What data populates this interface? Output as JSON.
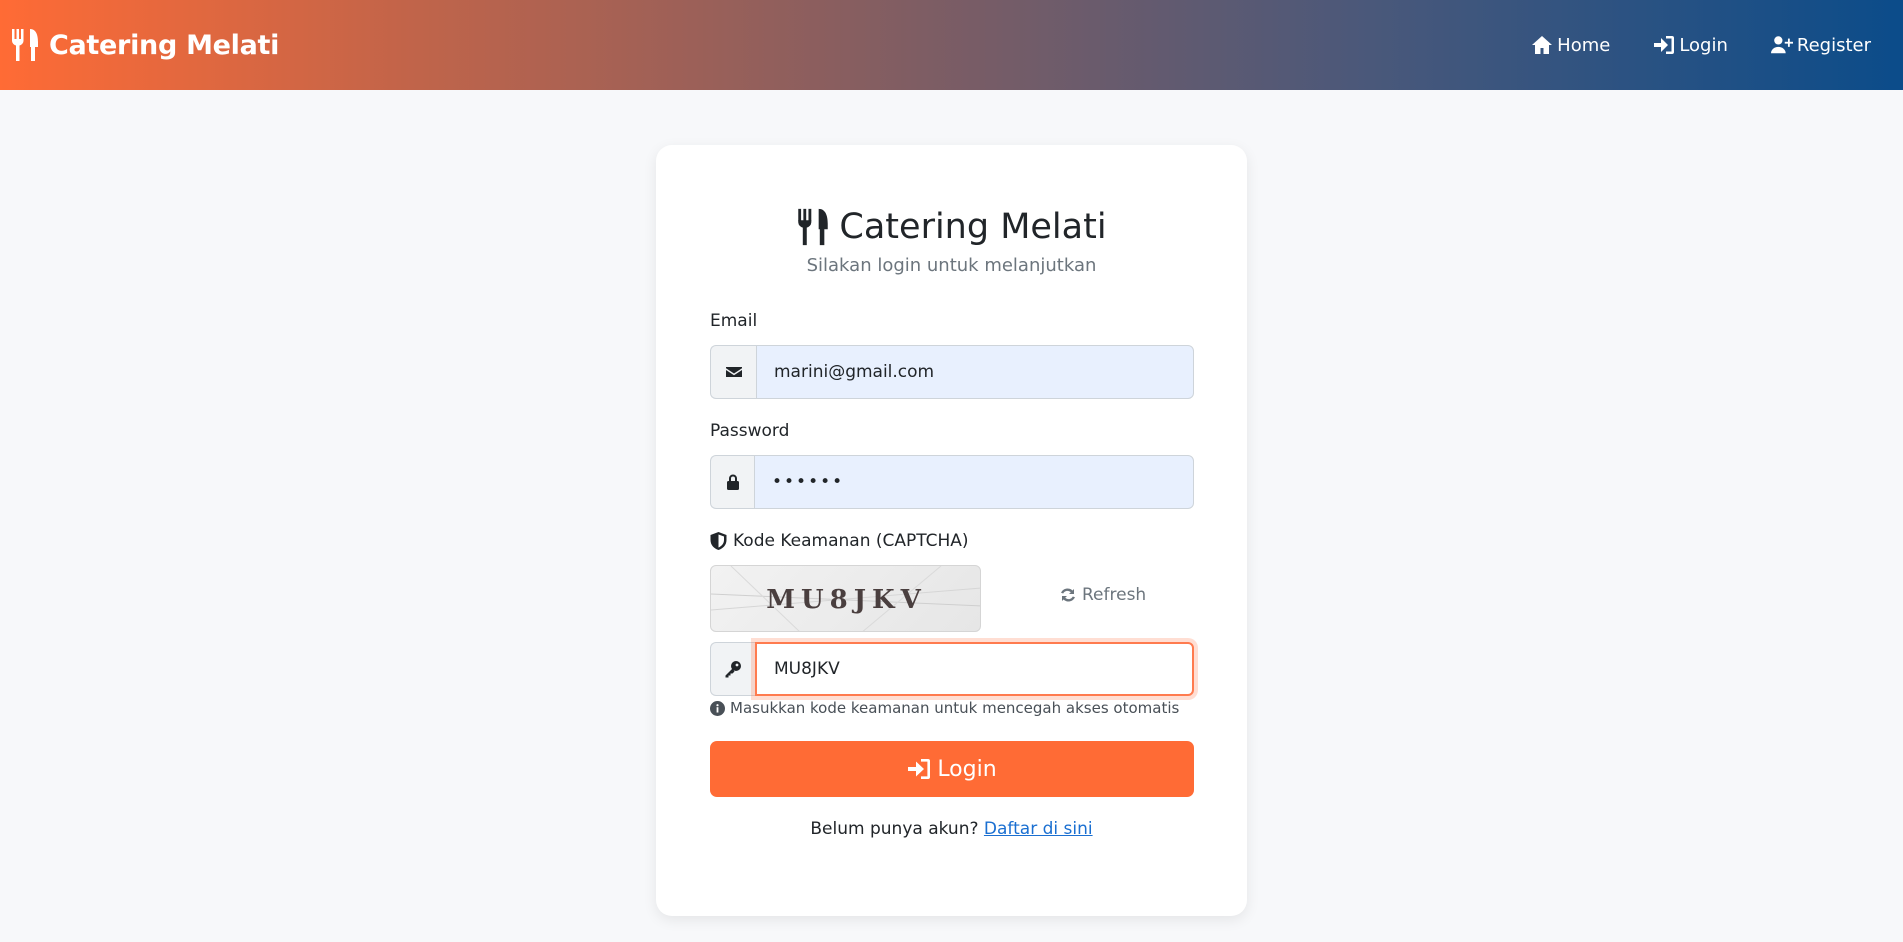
{
  "navbar": {
    "brand": "Catering Melati",
    "links": [
      {
        "label": "Home",
        "icon": "home-icon"
      },
      {
        "label": "Login",
        "icon": "sign-in-icon"
      },
      {
        "label": "Register",
        "icon": "user-plus-icon"
      }
    ],
    "gradient": [
      "#ff6b35",
      "#0b4c8a"
    ]
  },
  "card": {
    "title": "Catering Melati",
    "subtitle": "Silakan login untuk melanjutkan",
    "email": {
      "label": "Email",
      "value": "marini@gmail.com",
      "icon": "envelope-icon"
    },
    "password": {
      "label": "Password",
      "value": "••••••",
      "icon": "lock-icon"
    },
    "captcha": {
      "label": "Kode Keamanan (CAPTCHA)",
      "image_text": "MU8JKV",
      "refresh_label": "Refresh",
      "input_value": "MU8JKV",
      "input_icon": "key-icon",
      "help_text": "Masukkan kode keamanan untuk mencegah akses otomatis"
    },
    "login_button": "Login",
    "register_prompt": "Belum punya akun?",
    "register_link": "Daftar di sini"
  },
  "colors": {
    "accent": "#ff6b35",
    "link": "#1a6fd1",
    "field_autofill": "#e8f0fe"
  }
}
